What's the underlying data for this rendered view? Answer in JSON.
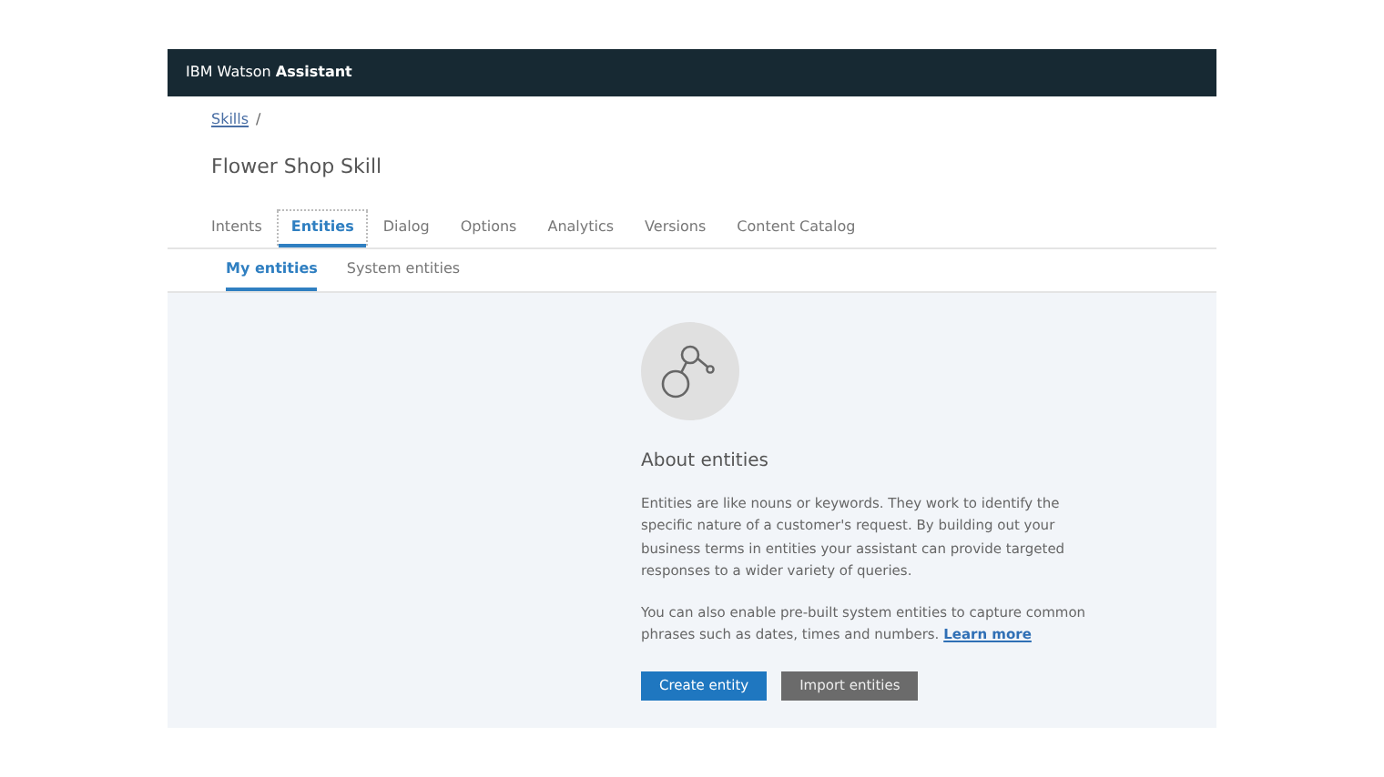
{
  "header": {
    "brand": "IBM Watson **Assistant**"
  },
  "breadcrumb": {
    "link": "Skills",
    "separator": "/"
  },
  "title": "Flower Shop Skill",
  "tabs": [
    {
      "label": "Intents",
      "selected": false
    },
    {
      "label": "Entities",
      "selected": true
    },
    {
      "label": "Dialog",
      "selected": false
    },
    {
      "label": "Options",
      "selected": false
    },
    {
      "label": "Analytics",
      "selected": false
    },
    {
      "label": "Versions",
      "selected": false
    },
    {
      "label": "Content Catalog",
      "selected": false
    }
  ],
  "subtabs": [
    {
      "label": "My entities",
      "selected": true
    },
    {
      "label": "System entities",
      "selected": false
    }
  ],
  "empty_state": {
    "heading": "About entities",
    "paragraph_1": "Entities are like nouns or keywords. They work to identify the specific nature of a customer's request. By building out your business terms in entities your assistant can provide targeted responses to a wider variety of queries.",
    "paragraph_2": "You can also enable pre-built system entities to capture common phrases such as dates, times and numbers.",
    "link": "Learn more",
    "buttons": [
      {
        "label": "Create entity",
        "kind": "primary"
      },
      {
        "label": "Import entities",
        "kind": "secondary"
      }
    ]
  }
}
